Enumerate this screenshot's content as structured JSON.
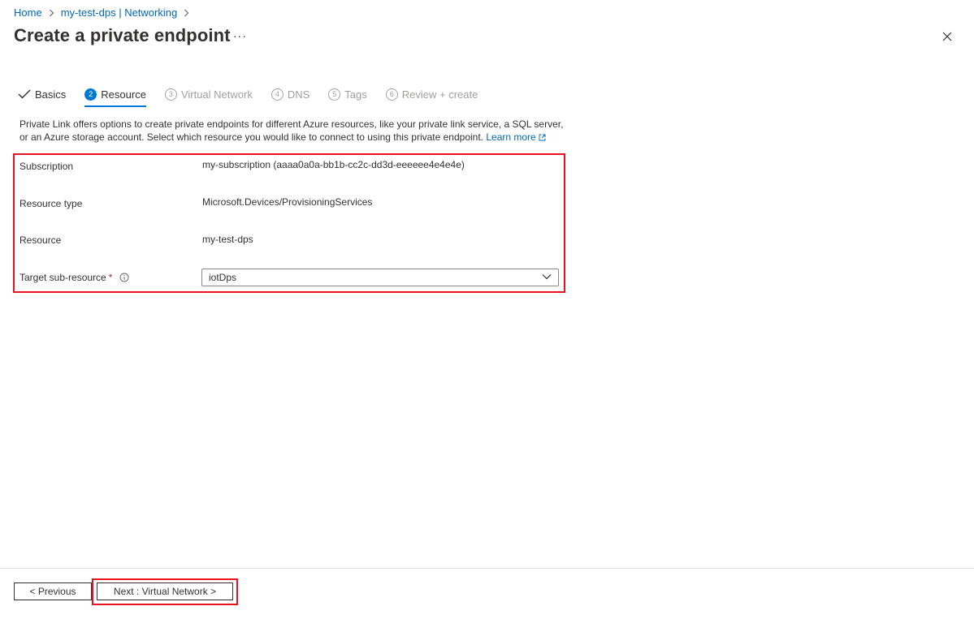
{
  "breadcrumb": {
    "home": "Home",
    "parent": "my-test-dps | Networking"
  },
  "page": {
    "title": "Create a private endpoint",
    "more": "···"
  },
  "tabs": [
    {
      "label": "Basics",
      "state": "completed"
    },
    {
      "number": "2",
      "label": "Resource",
      "state": "active"
    },
    {
      "number": "3",
      "label": "Virtual Network",
      "state": "disabled"
    },
    {
      "number": "4",
      "label": "DNS",
      "state": "disabled"
    },
    {
      "number": "5",
      "label": "Tags",
      "state": "disabled"
    },
    {
      "number": "6",
      "label": "Review + create",
      "state": "disabled"
    }
  ],
  "description": {
    "text": "Private Link offers options to create private endpoints for different Azure resources, like your private link service, a SQL server, or an Azure storage account. Select which resource you would like to connect to using this private endpoint.",
    "learn_more": "Learn more"
  },
  "form": {
    "subscription": {
      "label": "Subscription",
      "value": "my-subscription (aaaa0a0a-bb1b-cc2c-dd3d-eeeeee4e4e4e)"
    },
    "resource_type": {
      "label": "Resource type",
      "value": "Microsoft.Devices/ProvisioningServices"
    },
    "resource": {
      "label": "Resource",
      "value": "my-test-dps"
    },
    "target_sub_resource": {
      "label": "Target sub-resource",
      "required_mark": "*",
      "value": "iotDps"
    }
  },
  "footer": {
    "previous": "< Previous",
    "next": "Next : Virtual Network >"
  },
  "colors": {
    "link": "#0067b8",
    "accent": "#0078d4",
    "highlight": "#e81123",
    "required": "#a4262c",
    "disabled": "#a19f9d"
  }
}
